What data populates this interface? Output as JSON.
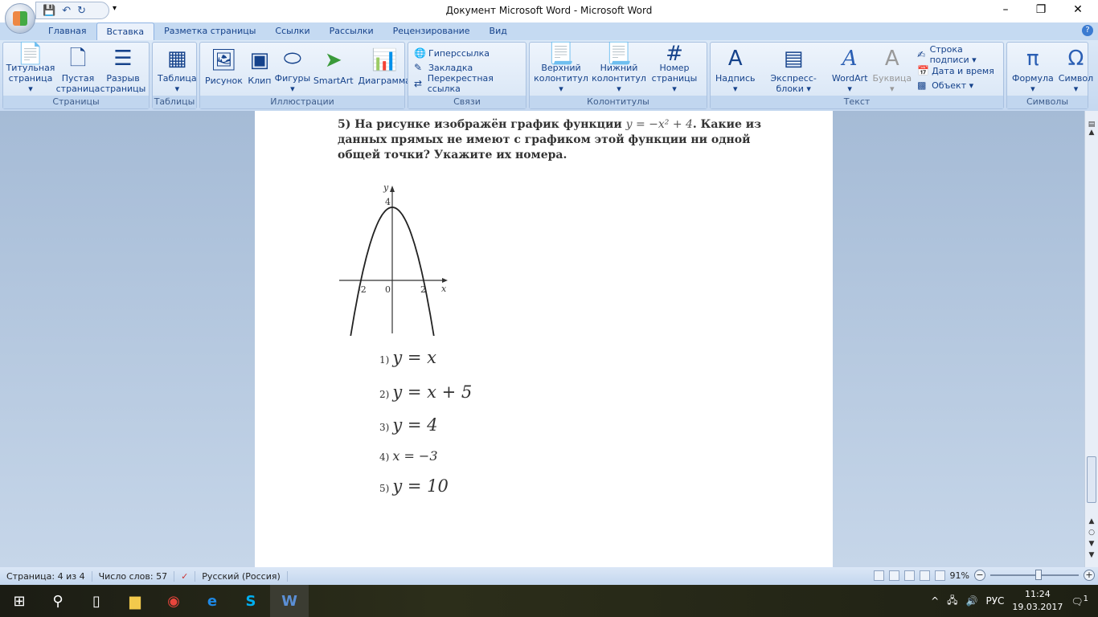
{
  "window": {
    "title": "Документ Microsoft Word - Microsoft Word"
  },
  "tabs": [
    "Главная",
    "Вставка",
    "Разметка страницы",
    "Ссылки",
    "Рассылки",
    "Рецензирование",
    "Вид"
  ],
  "ribbon": {
    "pages": {
      "label": "Страницы",
      "items": [
        "Титульная страница ▾",
        "Пустая страница",
        "Разрыв страницы"
      ]
    },
    "tables": {
      "label": "Таблицы",
      "items": [
        "Таблица ▾"
      ]
    },
    "illustrations": {
      "label": "Иллюстрации",
      "items": [
        "Рисунок",
        "Клип",
        "Фигуры ▾",
        "SmartArt",
        "Диаграмма"
      ]
    },
    "links": {
      "label": "Связи",
      "items": [
        "Гиперссылка",
        "Закладка",
        "Перекрестная ссылка"
      ]
    },
    "headers": {
      "label": "Колонтитулы",
      "items": [
        "Верхний колонтитул ▾",
        "Нижний колонтитул ▾",
        "Номер страницы ▾"
      ]
    },
    "text": {
      "label": "Текст",
      "items": [
        "Надпись ▾",
        "Экспресс-блоки ▾",
        "WordArt ▾",
        "Буквица ▾"
      ],
      "small": [
        "Строка подписи ▾",
        "Дата и время",
        "Объект ▾"
      ]
    },
    "symbols": {
      "label": "Символы",
      "items": [
        "Формула ▾",
        "Символ ▾"
      ]
    }
  },
  "document": {
    "question_prefix": "5) На рисунке изображён график функции ",
    "formula": "y = −x² + 4",
    "question_suffix": ". Какие из данных прямых не имеют с графиком этой функции ни одной общей точки? Укажите их номера.",
    "graph": {
      "y_label": "y",
      "x_label": "x",
      "ticks": {
        "y4": "4",
        "xm2": "-2",
        "x0": "0",
        "x2": "2"
      }
    },
    "options": [
      {
        "num": "1)",
        "eq": "y = x"
      },
      {
        "num": "2)",
        "eq": "y = x + 5"
      },
      {
        "num": "3)",
        "eq": "y = 4"
      },
      {
        "num": "4)",
        "eq": "x = −3"
      },
      {
        "num": "5)",
        "eq": "y = 10"
      }
    ]
  },
  "chart_data": {
    "type": "line",
    "function": "y = -x^2 + 4",
    "xlim": [
      -3.3,
      3.3
    ],
    "ylim": [
      -2,
      4.5
    ],
    "x_ticks": [
      -2,
      0,
      2
    ],
    "y_ticks": [
      4
    ]
  },
  "status": {
    "page": "Страница: 4 из 4",
    "words": "Число слов: 57",
    "lang": "Русский (Россия)",
    "zoom": "91%",
    "zoom_percent": 91
  },
  "taskbar": {
    "lang": "РУС",
    "time": "11:24",
    "date": "19.03.2017",
    "notifications": "1"
  }
}
